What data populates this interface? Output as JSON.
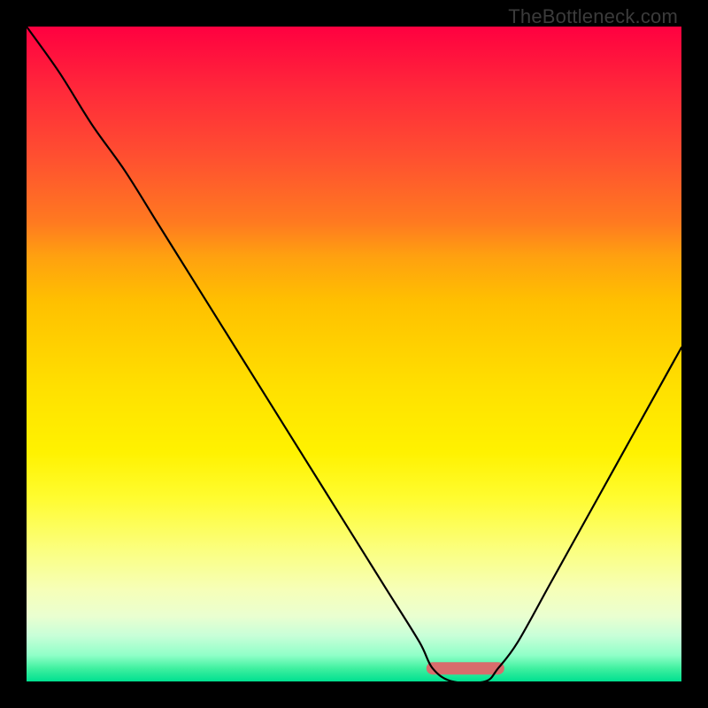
{
  "watermark": "TheBottleneck.com",
  "chart_data": {
    "type": "line",
    "title": "",
    "xlabel": "",
    "ylabel": "",
    "xlim": [
      0,
      100
    ],
    "ylim": [
      0,
      100
    ],
    "x": [
      0,
      5,
      10,
      15,
      20,
      25,
      30,
      35,
      40,
      45,
      50,
      55,
      60,
      62,
      65,
      70,
      72,
      75,
      80,
      85,
      90,
      95,
      100
    ],
    "values": [
      100,
      93,
      85,
      78,
      70,
      62,
      54,
      46,
      38,
      30,
      22,
      14,
      6,
      2,
      0,
      0,
      2,
      6,
      15,
      24,
      33,
      42,
      51
    ],
    "flat_segment": {
      "x_start": 62,
      "x_end": 72,
      "y": 2,
      "color": "#d86c6c",
      "thickness_px": 14
    },
    "grid": false,
    "legend": false
  }
}
